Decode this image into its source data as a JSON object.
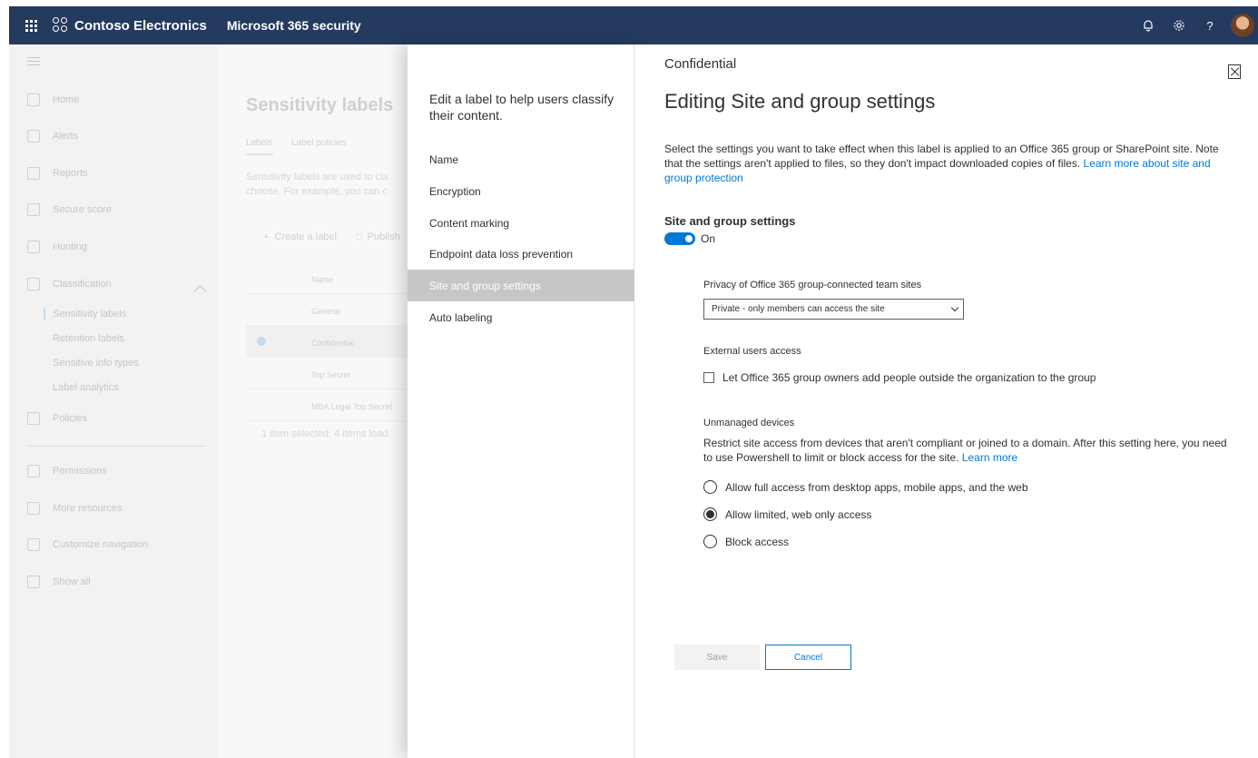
{
  "topbar": {
    "org_name": "Contoso Electronics",
    "app_name": "Microsoft 365 security"
  },
  "leftnav": {
    "items": [
      {
        "label": "Home",
        "icon": "home-icon"
      },
      {
        "label": "Alerts",
        "icon": "alert-icon"
      },
      {
        "label": "Reports",
        "icon": "chart-icon"
      },
      {
        "label": "Secure score",
        "icon": "trophy-icon"
      },
      {
        "label": "Hunting",
        "icon": "hunting-icon"
      },
      {
        "label": "Classification",
        "icon": "classification-icon"
      }
    ],
    "sub_items": [
      "Sensitivity labels",
      "Retention labels",
      "Sensitive info types",
      "Label analytics"
    ],
    "bottom_items": [
      {
        "label": "Policies",
        "icon": "policies-icon"
      },
      {
        "label": "Permissions",
        "icon": "key-icon"
      },
      {
        "label": "More resources",
        "icon": "info-icon"
      },
      {
        "label": "Customize navigation",
        "icon": "pencil-icon"
      },
      {
        "label": "Show all",
        "icon": "more-icon"
      }
    ]
  },
  "bgpage": {
    "title": "Sensitivity labels",
    "tabs": [
      "Labels",
      "Label policies"
    ],
    "desc_line1": "Sensitivity labels are used to cla",
    "desc_line2": "choose. For example, you can c",
    "cmd_create": "Create a label",
    "cmd_publish": "Publish",
    "column_name": "Name",
    "rows": [
      "General",
      "Confidential",
      "Top Secret",
      "MBA Legal Top Secret"
    ],
    "status": "1 item selected.  4 items load"
  },
  "steps": {
    "intro": "Edit a label to help users classify their content.",
    "items": [
      "Name",
      "Encryption",
      "Content marking",
      "Endpoint data loss prevention",
      "Site and group settings",
      "Auto labeling"
    ],
    "selected_index": 4
  },
  "editor": {
    "label_name": "Confidential",
    "title": "Editing Site and group settings",
    "description": "Select the settings you want to take effect when this label is applied to an Office 365 group or SharePoint site. Note that the settings aren't applied to files, so they don't impact downloaded copies of files. ",
    "description_link": "Learn more about site and group protection",
    "section_title": "Site and group settings",
    "toggle_label": "On",
    "toggle_on": true,
    "privacy_label": "Privacy of Office 365 group-connected team sites",
    "privacy_value": "Private - only members can access the site",
    "external_label": "External users access",
    "external_checkbox": "Let Office 365 group owners add people outside the organization to the group",
    "external_checked": false,
    "unmanaged_label": "Unmanaged devices",
    "unmanaged_desc": "Restrict site access from devices that aren't compliant or joined to a domain. After this setting here, you need to use Powershell to limit or block access for the site. ",
    "unmanaged_link": "Learn more",
    "radio_options": [
      "Allow full access from desktop apps, mobile apps, and the web",
      "Allow limited, web only access",
      "Block access"
    ],
    "radio_selected_index": 1,
    "save_label": "Save",
    "cancel_label": "Cancel"
  },
  "colors": {
    "topbar": "#243a5e",
    "accent": "#0078d4",
    "selected_step": "#c8c6c4"
  }
}
